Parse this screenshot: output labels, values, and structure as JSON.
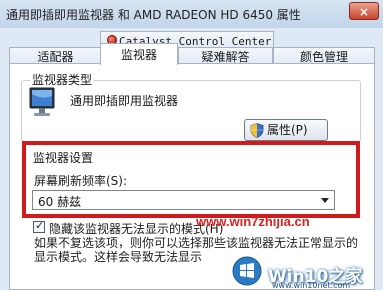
{
  "window": {
    "title": "通用即插即用监视器 和 AMD RADEON HD 6450 属性",
    "close_symbol": "×"
  },
  "tabs": {
    "row1": [
      {
        "label": "Catalyst Control Center",
        "icon": "catalyst-icon"
      }
    ],
    "row2": [
      {
        "label": "适配器"
      },
      {
        "label": "监视器",
        "selected": true
      },
      {
        "label": "疑难解答"
      },
      {
        "label": "颜色管理"
      }
    ]
  },
  "monitor_type": {
    "legend": "监视器类型",
    "icon": "monitor-icon",
    "name": "通用即插即用监视器",
    "properties_button": "属性(P)"
  },
  "monitor_settings": {
    "legend": "监视器设置",
    "refresh_label": "屏幕刷新频率(S):",
    "refresh_value": "60 赫兹",
    "hide_modes_checkbox": {
      "checked": true,
      "label": "隐藏该监视器无法显示的模式(H)"
    },
    "help_lines": [
      "如果不复选该项，则你可以选择那些该监视器无法正常显示的",
      "显示模式。这样会导致无法显示"
    ]
  },
  "watermarks": {
    "url": "www.win7zhijia.cn",
    "site_name": "Win10之家",
    "site_url": "www.win10net.com"
  },
  "colors": {
    "highlight_box": "#d11a1a",
    "watermark_red": "#e02020"
  }
}
